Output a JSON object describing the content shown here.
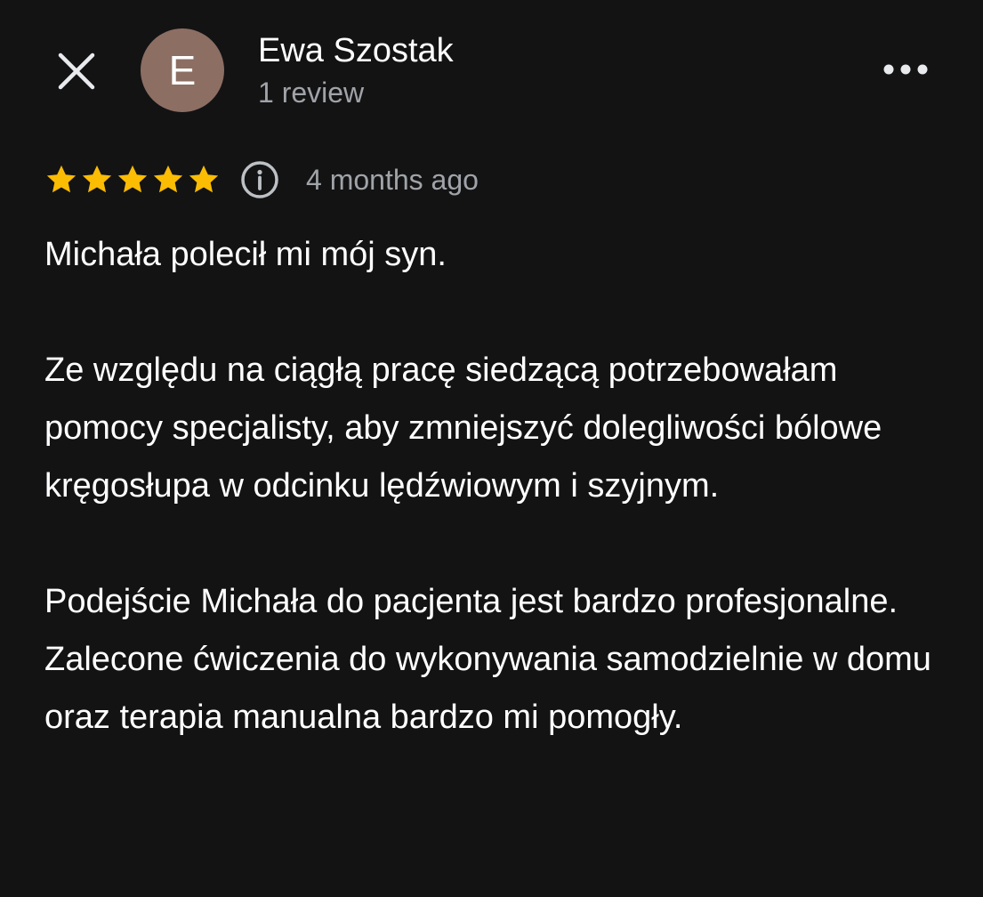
{
  "header": {
    "close_icon": "close-icon",
    "avatar_letter": "E",
    "avatar_color": "#8d6e63",
    "author_name": "Ewa Szostak",
    "review_count": "1 review",
    "more_icon": "more-horizontal-icon"
  },
  "rating": {
    "stars": 5,
    "max_stars": 5,
    "star_color": "#fbbc04",
    "info_icon": "info-icon",
    "time_ago": "4 months ago"
  },
  "review": {
    "paragraphs": [
      "Michała polecił mi mój syn.",
      "Ze względu na ciągłą pracę siedzącą potrzebowałam pomocy specjalisty, aby zmniejszyć dolegliwości bólowe kręgosłupa w odcinku lędźwiowym i szyjnym.",
      "Podejście Michała do pacjenta jest bardzo profesjonalne. Zalecone ćwiczenia do wykonywania samodzielnie w domu oraz terapia manualna bardzo mi pomogły."
    ]
  }
}
